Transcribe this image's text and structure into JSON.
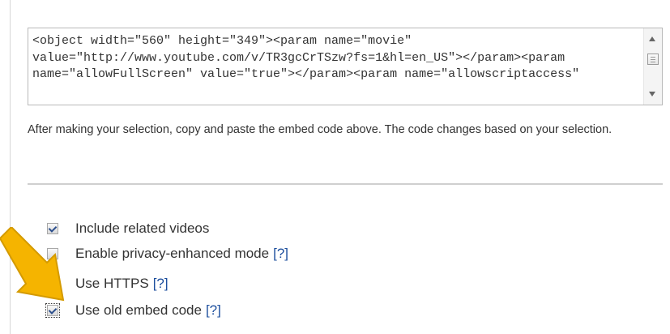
{
  "embed": {
    "code": "<object width=\"560\" height=\"349\"><param name=\"movie\" value=\"http://www.youtube.com/v/TR3gcCrTSzw?fs=1&hl=en_US\"></param><param name=\"allowFullScreen\" value=\"true\"></param><param name=\"allowscriptaccess\""
  },
  "help_text": "After making your selection, copy and paste the embed code above. The code changes based on your selection.",
  "options": [
    {
      "label": "Include related videos",
      "checked": true,
      "help": ""
    },
    {
      "label": "Enable privacy-enhanced mode",
      "checked": false,
      "help": "[?]"
    },
    {
      "label": "Use HTTPS",
      "checked": false,
      "help": "[?]"
    },
    {
      "label": "Use old embed code",
      "checked": true,
      "help": "[?]"
    }
  ],
  "colors": {
    "annotation_arrow": "#f5b400",
    "link": "#1d4f9e",
    "check": "#2c4f8c"
  },
  "icons": {
    "scroll_up": "scroll-up-arrow-icon",
    "scroll_down": "scroll-down-arrow-icon",
    "annotation": "annotation-arrow-icon"
  }
}
